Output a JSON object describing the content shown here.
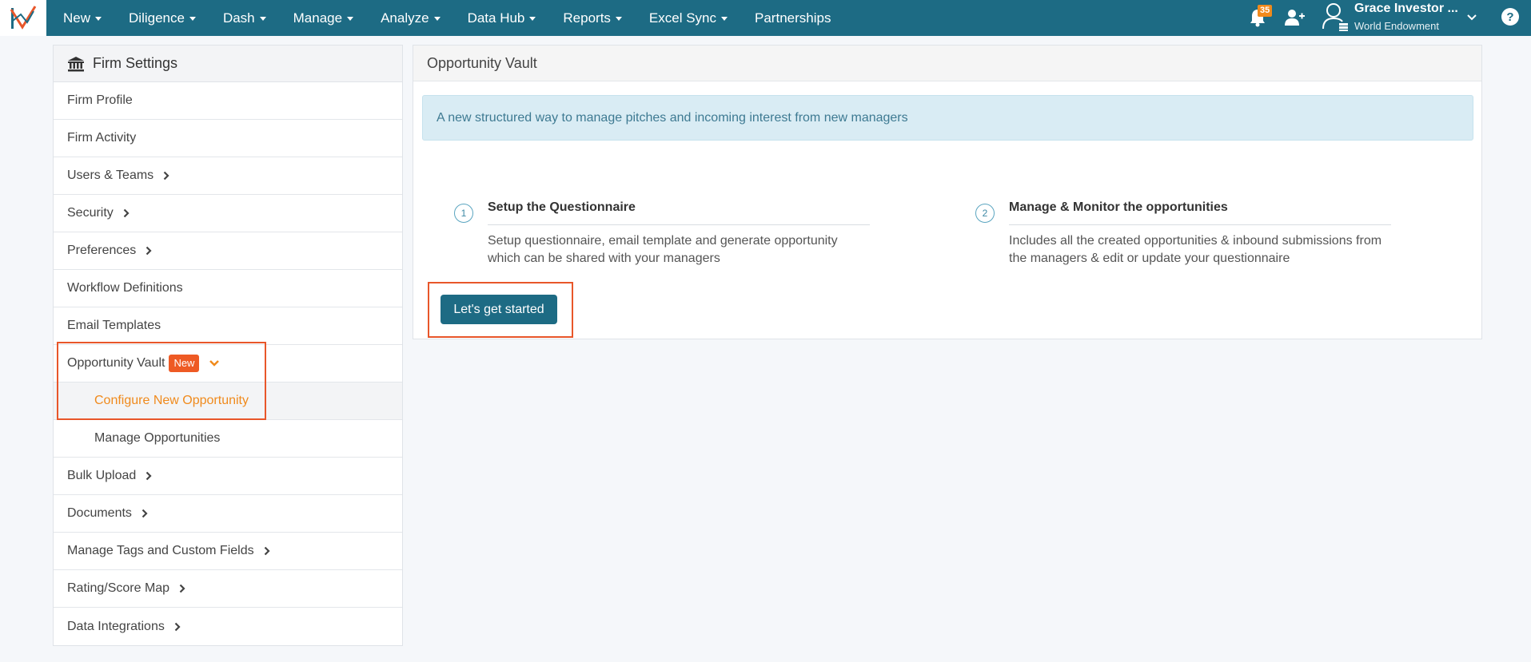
{
  "navbar": {
    "items": [
      {
        "label": "New",
        "has_caret": true
      },
      {
        "label": "Diligence",
        "has_caret": true
      },
      {
        "label": "Dash",
        "has_caret": true
      },
      {
        "label": "Manage",
        "has_caret": true
      },
      {
        "label": "Analyze",
        "has_caret": true
      },
      {
        "label": "Data Hub",
        "has_caret": true
      },
      {
        "label": "Reports",
        "has_caret": true
      },
      {
        "label": "Excel Sync",
        "has_caret": true
      },
      {
        "label": "Partnerships",
        "has_caret": false
      }
    ],
    "notification_count": "35",
    "user_name": "Grace Investor ...",
    "user_org": "World Endowment",
    "help_label": "?",
    "colors": {
      "bar": "#1d6b84",
      "badge": "#f08a1c"
    }
  },
  "sidebar": {
    "title": "Firm Settings",
    "items": [
      {
        "label": "Firm Profile"
      },
      {
        "label": "Firm Activity"
      },
      {
        "label": "Users & Teams"
      },
      {
        "label": "Security"
      },
      {
        "label": "Preferences"
      },
      {
        "label": "Workflow Definitions"
      },
      {
        "label": "Email Templates"
      },
      {
        "label": "Opportunity Vault",
        "badge": "New"
      },
      {
        "label": "Configure New Opportunity"
      },
      {
        "label": "Manage Opportunities"
      },
      {
        "label": "Bulk Upload"
      },
      {
        "label": "Documents"
      },
      {
        "label": "Manage Tags and Custom Fields"
      },
      {
        "label": "Rating/Score Map"
      },
      {
        "label": "Data Integrations"
      }
    ]
  },
  "main": {
    "title": "Opportunity Vault",
    "info": "A new structured way to manage pitches and incoming interest from new managers",
    "steps": [
      {
        "number": "1",
        "title": "Setup the Questionnaire",
        "desc": "Setup questionnaire, email template and generate opportunity which can be shared with your managers"
      },
      {
        "number": "2",
        "title": "Manage & Monitor the opportunities",
        "desc": "Includes all the created opportunities & inbound submissions from the managers & edit or update your questionnaire"
      }
    ],
    "cta_label": "Let's get started"
  },
  "accent": "#e8562a"
}
